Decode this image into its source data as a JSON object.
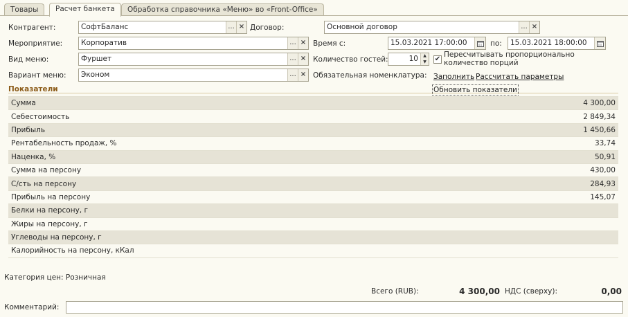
{
  "tabs": [
    {
      "label": "Товары"
    },
    {
      "label": "Расчет банкета"
    },
    {
      "label": "Обработка справочника «Меню» во «Front-Office»"
    }
  ],
  "form": {
    "counterparty_label": "Контрагент:",
    "counterparty_value": "СофтБаланс",
    "contract_label": "Договор:",
    "contract_value": "Основной договор",
    "event_label": "Мероприятие:",
    "event_value": "Корпоратив",
    "time_from_label": "Время с:",
    "time_from_value": "15.03.2021 17:00:00",
    "time_to_label": "по:",
    "time_to_value": "15.03.2021 18:00:00",
    "menu_type_label": "Вид меню:",
    "menu_type_value": "Фуршет",
    "guests_label": "Количество гостей:",
    "guests_value": "10",
    "recalc_checked": true,
    "recalc_label": "Пересчитывать пропорционально количество порций",
    "menu_variant_label": "Вариант меню:",
    "menu_variant_value": "Эконом",
    "mandatory_label": "Обязательная номенклатура:",
    "fill_link": "Заполнить",
    "calc_params_link": "Рассчитать параметры",
    "refresh_link": "Обновить показатели",
    "select_glyph": "...",
    "clear_glyph": "×"
  },
  "indicators": {
    "title": "Показатели",
    "rows": [
      {
        "name": "Сумма",
        "value": "4 300,00"
      },
      {
        "name": "Себестоимость",
        "value": "2 849,34"
      },
      {
        "name": "Прибыль",
        "value": "1 450,66"
      },
      {
        "name": "Рентабельность продаж, %",
        "value": "33,74"
      },
      {
        "name": "Наценка, %",
        "value": "50,91"
      },
      {
        "name": "Сумма на персону",
        "value": "430,00"
      },
      {
        "name": "С/сть на персону",
        "value": "284,93"
      },
      {
        "name": "Прибыль на персону",
        "value": "145,07"
      },
      {
        "name": "Белки на персону, г",
        "value": ""
      },
      {
        "name": "Жиры на персону, г",
        "value": ""
      },
      {
        "name": "Углеводы на персону, г",
        "value": ""
      },
      {
        "name": "Калорийность на персону, кКал",
        "value": ""
      }
    ]
  },
  "footer": {
    "price_category": "Категория цен: Розничная",
    "total_label": "Всего (RUB):",
    "total_value": "4 300,00",
    "vat_label": "НДС (сверху):",
    "vat_value": "0,00",
    "comment_label": "Комментарий:",
    "comment_value": ""
  },
  "colors": {
    "background": "#fbfaf2",
    "section_title": "#8c5c19",
    "row_alt": "#e6e3d6"
  }
}
